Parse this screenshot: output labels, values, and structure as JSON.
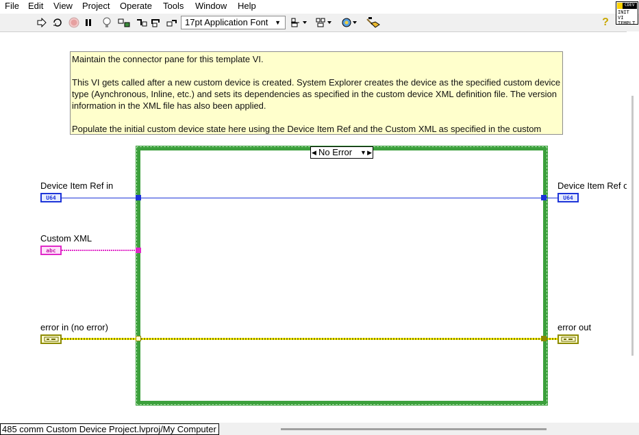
{
  "menu": [
    "File",
    "Edit",
    "View",
    "Project",
    "Operate",
    "Tools",
    "Window",
    "Help"
  ],
  "toolbar": {
    "font": "17pt Application Font",
    "help_icon": "?"
  },
  "vi_icon": {
    "line1": "CDEV",
    "line2": "INIT VI",
    "line3": "TEMPLT"
  },
  "comment": {
    "p1": "Maintain the connector pane for this template VI.",
    "p2": "This VI gets called after a new custom device is created. System Explorer creates the device as the specified custom device type (Aynchronous, Inline, etc.) and sets its dependencies as specified in the custom device XML definition file. The version information in the XML file has also been applied.",
    "p3": "Populate the initial custom device state here using the Device Item Ref and the Custom XML as specified in the custom"
  },
  "case_structure": {
    "selector": "No Error"
  },
  "terminals": {
    "device_ref_in": {
      "label": "Device Item Ref in",
      "type": "U64"
    },
    "custom_xml": {
      "label": "Custom XML",
      "type": "abc"
    },
    "error_in": {
      "label": "error in (no error)"
    },
    "device_ref_out": {
      "label": "Device Item Ref o",
      "type": "U64"
    },
    "error_out": {
      "label": "error out"
    }
  },
  "status": {
    "path": "485 comm Custom Device Project.lvproj/My Computer"
  },
  "colors": {
    "case_border": "#3ca03c",
    "u64_wire": "#1c33d8",
    "string_wire": "#e028c8",
    "error_wire": "#8c8a00",
    "comment_bg": "#ffffcc"
  }
}
